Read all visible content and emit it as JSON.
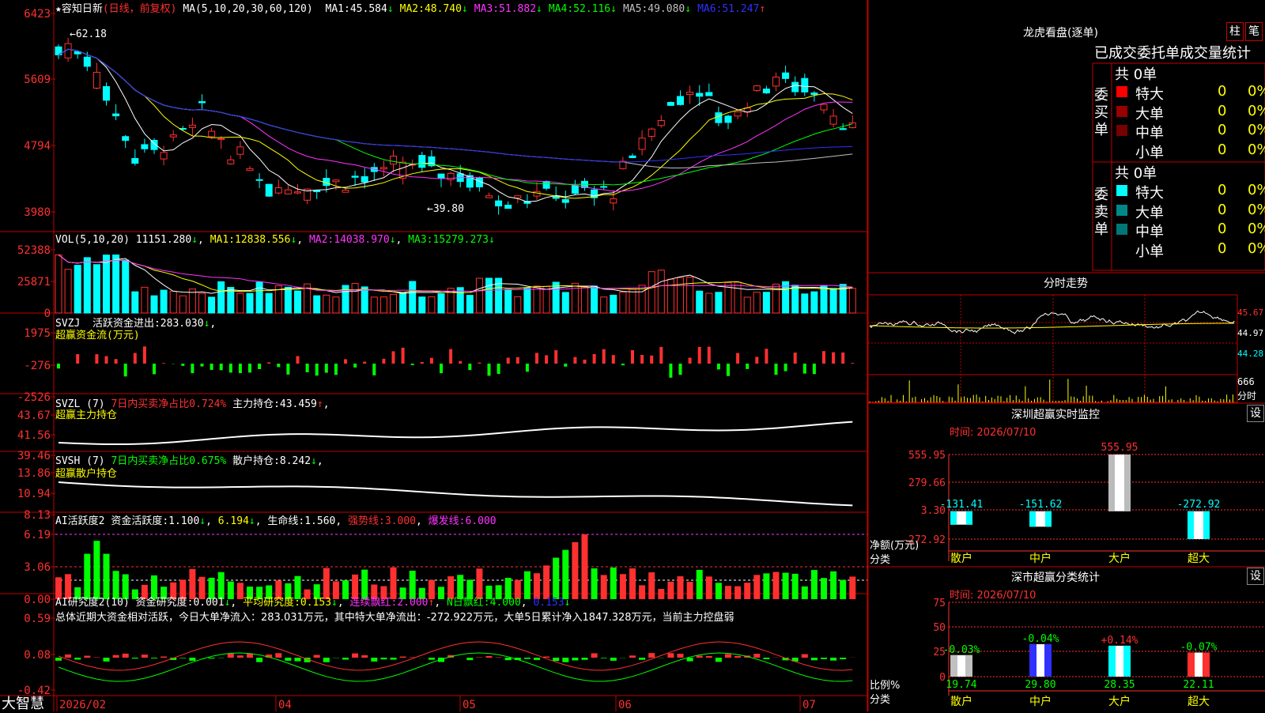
{
  "colors": {
    "up": "#ff3030",
    "down": "#00ffff",
    "frame": "#c00000",
    "yellow": "#ffff00",
    "magenta": "#ff33ff",
    "green": "#00ff00",
    "blue": "#3030ff",
    "white": "#ffffff",
    "grey": "#c0c0c0"
  },
  "app": {
    "name": "大智慧",
    "date_axis": [
      "2026/02",
      "04",
      "05",
      "06",
      "07"
    ]
  },
  "main": {
    "star": "★",
    "stock": "容知日新",
    "mode": "(日线，前复权)",
    "ma_params": "MA(5,10,20,30,60,120)",
    "ma": [
      {
        "label": "MA1:",
        "value": "45.584",
        "arrow": "↓",
        "color": "#ffffff"
      },
      {
        "label": "MA2:",
        "value": "48.740",
        "arrow": "↓",
        "color": "#ffff00"
      },
      {
        "label": "MA3:",
        "value": "51.882",
        "arrow": "↓",
        "color": "#ff33ff"
      },
      {
        "label": "MA4:",
        "value": "52.116",
        "arrow": "↓",
        "color": "#00ff00"
      },
      {
        "label": "MA5:",
        "value": "49.080",
        "arrow": "↓",
        "color": "#c0c0c0"
      },
      {
        "label": "MA6:",
        "value": "51.247",
        "arrow": "↑",
        "color": "#3030ff"
      }
    ],
    "yticks": [
      "6423",
      "5609",
      "4794",
      "3980"
    ],
    "high_note": "←62.18",
    "low_note": "←39.80"
  },
  "vol": {
    "title": "VOL(5,10,20)",
    "value": "11151.280",
    "arrow": "↓",
    "ma": [
      {
        "label": "MA1:",
        "value": "12838.556",
        "arrow": "↓"
      },
      {
        "label": "MA2:",
        "value": "14038.970",
        "arrow": "↓"
      },
      {
        "label": "MA3:",
        "value": "15279.273",
        "arrow": "↓"
      }
    ],
    "yticks": [
      "52388",
      "25871",
      "0"
    ]
  },
  "svzj": {
    "title": "SVZJ",
    "label": "活跃资金进出:",
    "value": "283.030",
    "arrow": "↓",
    "sub": "超赢资金流(万元)",
    "yticks": [
      "1975",
      "-276",
      "-2526"
    ]
  },
  "svzl": {
    "title": "SVZL (7)",
    "note": "7日内买卖净占比0.724%",
    "label": "主力持仓:",
    "value": "43.459",
    "arrow": "↑",
    "sub": "超赢主力持仓",
    "yticks": [
      "43.67",
      "41.56",
      "39.46"
    ]
  },
  "svsh": {
    "title": "SVSH (7)",
    "note": "7日内买卖净占比0.675%",
    "label": "散户持仓:",
    "value": "8.242",
    "arrow": "↓",
    "sub": "超赢散户持仓",
    "yticks": [
      "13.86",
      "10.94",
      "8.13"
    ]
  },
  "ai1": {
    "title": "AI活跃度2",
    "a": "资金活跃度:",
    "av": "1.100",
    "aa": "↓",
    "b": "6.194",
    "ba": "↓",
    "c": "生命线:",
    "cv": "1.560",
    "d": "强势线:",
    "dv": "3.000",
    "e": "爆发线:",
    "ev": "6.000",
    "yticks": [
      "6.19",
      "3.06",
      "0.00"
    ]
  },
  "ai2": {
    "title": "AI研究度2(10)",
    "a": "资金研究度:",
    "av": "0.001",
    "aa": "↓",
    "b": "平均研究度:",
    "bv": "0.153",
    "ba": "↓",
    "c": "连续飘红:",
    "cv": "2.000",
    "ca": "↑",
    "d": "N日飘红:",
    "dv": "4.000",
    "e": "0.153",
    "ea": "↓",
    "summary": "总体近期大资金相对活跃，今日大单净流入：283.031万元，其中特大单净流出：-272.922万元，大单5日累计净入1847.328万元，当前主力控盘弱",
    "yticks": [
      "0.59",
      "0.08",
      "-0.42"
    ]
  },
  "panel": {
    "title": "龙虎看盘(逐单)",
    "btn1": "柱",
    "btn2": "笔",
    "header": "已成交委托单成交量统计",
    "buy_label": "委买单",
    "sell_label": "委卖单",
    "buy_total": "共 0单",
    "sell_total": "共 0单",
    "buy_rows": [
      {
        "name": "特大",
        "val": "0",
        "pct": "0%",
        "sw": "#ff0000"
      },
      {
        "name": "大单",
        "val": "0",
        "pct": "0%",
        "sw": "#990000"
      },
      {
        "name": "中单",
        "val": "0",
        "pct": "0%",
        "sw": "#770000"
      },
      {
        "name": "小单",
        "val": "0",
        "pct": "0%",
        "sw": ""
      }
    ],
    "sell_rows": [
      {
        "name": "特大",
        "val": "0",
        "pct": "0%",
        "sw": "#00ffff"
      },
      {
        "name": "大单",
        "val": "0",
        "pct": "0%",
        "sw": "#008888"
      },
      {
        "name": "中单",
        "val": "0",
        "pct": "0%",
        "sw": "#007777"
      },
      {
        "name": "小单",
        "val": "0",
        "pct": "0%",
        "sw": ""
      }
    ]
  },
  "intraday": {
    "title": "分时走势",
    "y": [
      "45.67",
      "44.97",
      "44.28"
    ],
    "vol": "666",
    "vol_label": "分时"
  },
  "monitor": {
    "title": "深圳超赢实时监控",
    "btn": "设",
    "date": "时间: 2026/07/10",
    "yticks": [
      "555.95",
      "279.66",
      "3.30",
      "-272.92"
    ],
    "ylabel1": "净额(万元)",
    "ylabel2": "分类",
    "chart_data": {
      "type": "bar",
      "categories": [
        "散户",
        "中户",
        "大户",
        "超大"
      ],
      "values": [
        -131.41,
        -151.62,
        555.95,
        -272.92
      ],
      "value_labels": [
        "-131.41",
        "-151.62",
        "555.95",
        "-272.92"
      ],
      "ylim": [
        -272.92,
        555.95
      ]
    }
  },
  "stat": {
    "title": "深市超赢分类统计",
    "btn": "设",
    "date": "时间: 2026/07/10",
    "yticks": [
      "75",
      "50",
      "25",
      "0"
    ],
    "ylabel1": "比例%",
    "ylabel2": "分类",
    "chart_data": {
      "type": "bar",
      "categories": [
        "散户",
        "中户",
        "大户",
        "超大"
      ],
      "values": [
        19.74,
        29.8,
        28.35,
        22.11
      ],
      "labels": [
        "19.74",
        "29.80",
        "28.35",
        "22.11"
      ],
      "changes": [
        "-0.03%",
        "-0.04%",
        "+0.14%",
        "-0.07%"
      ],
      "ylim": [
        0,
        75
      ]
    }
  }
}
